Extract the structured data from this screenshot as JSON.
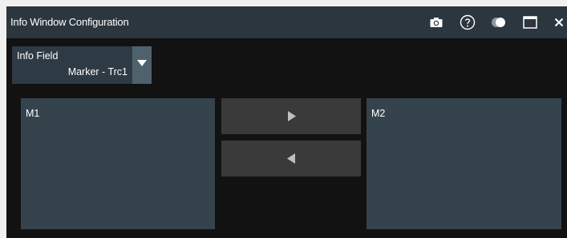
{
  "window": {
    "title": "Info Window Configuration",
    "titlebar_icons": [
      "camera-icon",
      "help-icon",
      "toggle-icon",
      "maximize-icon",
      "close-icon"
    ],
    "close_glyph": "×"
  },
  "info_field": {
    "label": "Info Field",
    "value": "Marker - Trc1"
  },
  "panels": {
    "left_label": "M1",
    "right_label": "M2"
  },
  "colors": {
    "titlebar": "#2b363f",
    "background": "#121212",
    "panel": "#35434d",
    "button": "#3a3a3a",
    "dropdown": "#4f616c"
  }
}
